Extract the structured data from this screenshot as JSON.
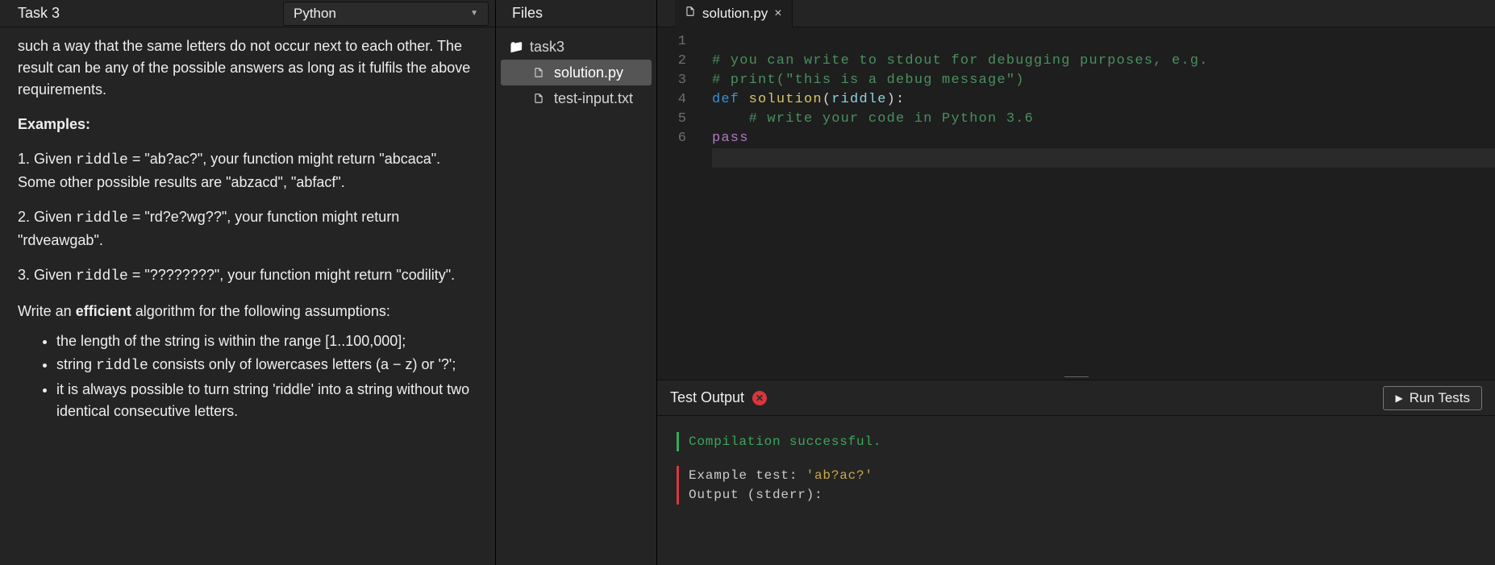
{
  "header": {
    "task_title": "Task 3",
    "language": "Python"
  },
  "problem": {
    "intro": "such a way that the same letters do not occur next to each other. The result can be any of the possible answers as long as it fulfils the above requirements.",
    "examples_heading": "Examples:",
    "ex1a": "1. Given ",
    "ex1b": " = \"ab?ac?\", your function might return \"abcaca\". Some other possible results are \"abzacd\", \"abfacf\".",
    "ex2a": "2. Given ",
    "ex2b": " = \"rd?e?wg??\", your function might return \"rdveawgab\".",
    "ex3a": "3. Given ",
    "ex3b": " = \"????????\", your function might return \"codility\".",
    "riddle_code": "riddle",
    "efficient_a": "Write an ",
    "efficient_b": "efficient",
    "efficient_c": " algorithm for the following assumptions:",
    "bullet1": "the length of the string is within the range [1..100,000];",
    "bullet2a": "string ",
    "bullet2b": " consists only of lowercases letters (a − z) or '?';",
    "bullet3": "it is always possible to turn string 'riddle' into a string without two identical consecutive letters."
  },
  "files": {
    "header": "Files",
    "folder": "task3",
    "file1": "solution.py",
    "file2": "test-input.txt"
  },
  "tabs": {
    "tab1": "solution.py"
  },
  "editor": {
    "lines": [
      "1",
      "2",
      "3",
      "4",
      "5",
      "6"
    ],
    "l1": "# you can write to stdout for debugging purposes, e.g.",
    "l2": "# print(\"this is a debug message\")",
    "l3_def": "def ",
    "l3_fn": "solution",
    "l3_open": "(",
    "l3_param": "riddle",
    "l3_close": "):",
    "l4": "    # write your code in Python 3.6",
    "l5": "pass"
  },
  "output": {
    "header": "Test Output",
    "run_button": "Run Tests",
    "compile_ok": "Compilation successful.",
    "example_test_label": "Example test:   ",
    "example_test_value": "'ab?ac?'",
    "stderr_label": "Output (stderr):"
  }
}
